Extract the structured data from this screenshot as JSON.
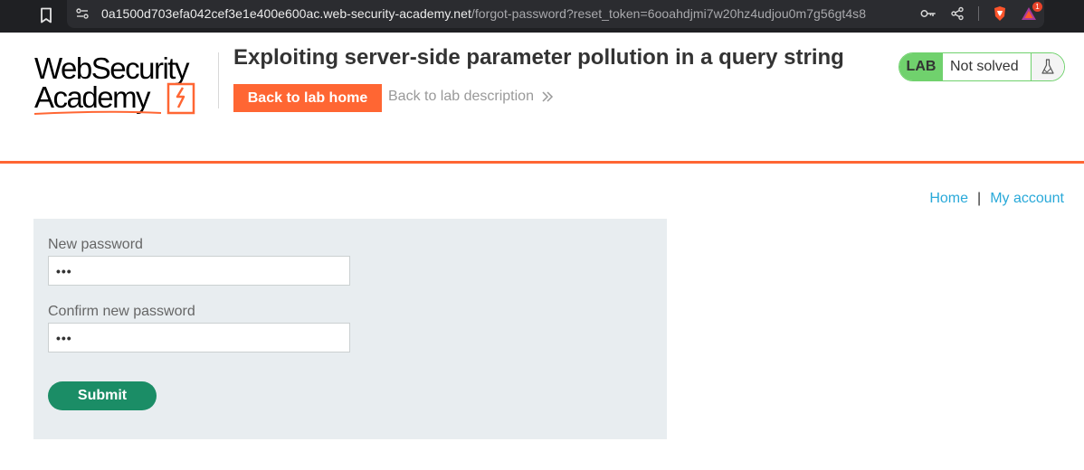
{
  "browser": {
    "url_host": "0a1500d703efa042cef3e1e400e600ac.web-security-academy.net",
    "url_path": "/forgot-password?reset_token=6ooahdjmi7w20hz4udjou0m7g56gt4s8",
    "icons": [
      "bookmark-icon",
      "site-info-icon",
      "key-icon",
      "share-icon",
      "brave-shield-icon",
      "brave-rewards-icon"
    ],
    "rewards_badge": "1"
  },
  "header": {
    "logo_line1": "WebSecurity",
    "logo_line2": "Academy",
    "lab_title": "Exploiting server-side parameter pollution in a query string",
    "back_home_label": "Back to lab home",
    "back_description_label": "Back to lab description",
    "status_tag": "LAB",
    "status_text": "Not solved"
  },
  "nav": {
    "home": "Home",
    "separator": "|",
    "my_account": "My account"
  },
  "form": {
    "new_password_label": "New password",
    "new_password_value": "•••",
    "confirm_password_label": "Confirm new password",
    "confirm_password_value": "•••",
    "submit_label": "Submit"
  },
  "colors": {
    "accent_orange": "#ff6633",
    "submit_green": "#1b8d66",
    "status_green": "#70d16d",
    "link_blue": "#29a9d9",
    "panel_bg": "#e8edf0"
  }
}
